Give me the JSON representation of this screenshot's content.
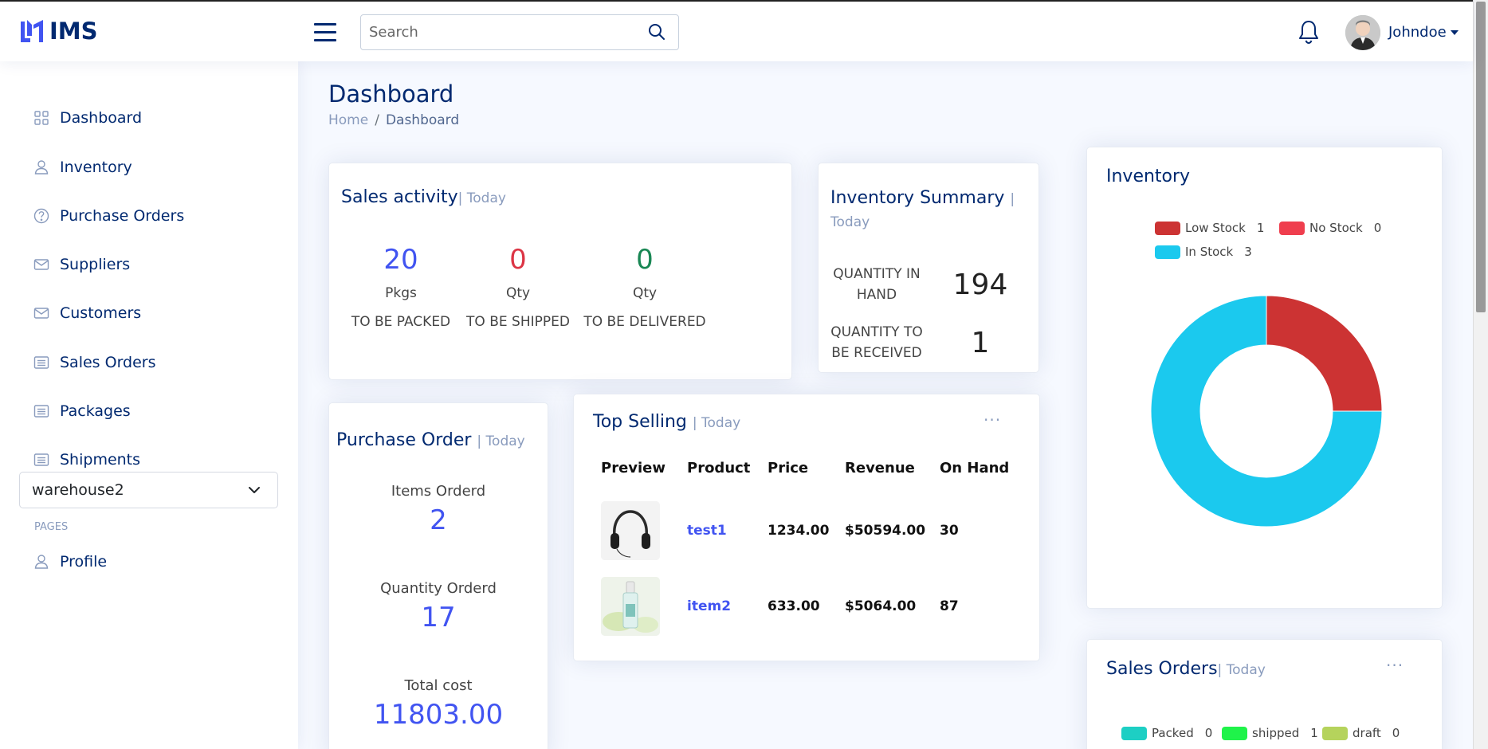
{
  "brand": {
    "name": "IMS"
  },
  "search": {
    "placeholder": "Search"
  },
  "user": {
    "name": "Johndoe"
  },
  "sidebar": {
    "items": [
      {
        "label": "Dashboard",
        "icon": "grid-icon"
      },
      {
        "label": "Inventory",
        "icon": "person-icon"
      },
      {
        "label": "Purchase Orders",
        "icon": "question-circle-icon"
      },
      {
        "label": "Suppliers",
        "icon": "envelope-icon"
      },
      {
        "label": "Customers",
        "icon": "envelope-icon"
      },
      {
        "label": "Sales Orders",
        "icon": "list-icon"
      },
      {
        "label": "Packages",
        "icon": "list-icon"
      },
      {
        "label": "Shipments",
        "icon": "list-icon"
      }
    ],
    "warehouse": {
      "selected": "warehouse2"
    },
    "pages_heading": "PAGES",
    "pages": [
      {
        "label": "Profile",
        "icon": "person-icon"
      }
    ]
  },
  "page": {
    "title": "Dashboard",
    "breadcrumb": {
      "home": "Home",
      "separator": "/",
      "current": "Dashboard"
    }
  },
  "sales_activity": {
    "title": "Sales activity",
    "period": "| Today",
    "stats": [
      {
        "value": "20",
        "unit": "Pkgs",
        "label": "TO BE PACKED",
        "color": "#4154f1"
      },
      {
        "value": "0",
        "unit": "Qty",
        "label": "TO BE SHIPPED",
        "color": "#dc3545"
      },
      {
        "value": "0",
        "unit": "Qty",
        "label": "TO BE DELIVERED",
        "color": "#198754"
      }
    ]
  },
  "inventory_summary": {
    "title": "Inventory Summary",
    "period": "| Today",
    "rows": [
      {
        "label": "QUANTITY IN HAND",
        "value": "194"
      },
      {
        "label": "QUANTITY TO BE RECEIVED",
        "value": "1"
      }
    ]
  },
  "purchase_order": {
    "title": "Purchase Order",
    "period": "| Today",
    "stats": [
      {
        "label": "Items Orderd",
        "value": "2"
      },
      {
        "label": "Quantity Orderd",
        "value": "17"
      },
      {
        "label": "Total cost",
        "value": "11803.00"
      }
    ]
  },
  "top_selling": {
    "title": "Top Selling",
    "period": "| Today",
    "menu": "...",
    "columns": [
      "Preview",
      "Product",
      "Price",
      "Revenue",
      "On Hand"
    ],
    "rows": [
      {
        "preview": "headphones-image",
        "product": "test1",
        "price": "1234.00",
        "revenue": "$50594.00",
        "on_hand": "30"
      },
      {
        "preview": "serum-bottle-image",
        "product": "item2",
        "price": "633.00",
        "revenue": "$5064.00",
        "on_hand": "87"
      }
    ]
  },
  "inventory_chart": {
    "title": "Inventory"
  },
  "chart_data": {
    "type": "pie",
    "variant": "doughnut",
    "title": "",
    "labels": [
      "Low Stock",
      "No Stock",
      "In Stock"
    ],
    "values": [
      1,
      0,
      3
    ],
    "colors": [
      "#cc3333",
      "#ef3e4e",
      "#1bc9ee"
    ],
    "legend": "top"
  },
  "sales_orders": {
    "title": "Sales Orders",
    "period": "| Today",
    "menu": "...",
    "legend": [
      {
        "label": "Packed",
        "count": "0",
        "color": "#1dcfc4"
      },
      {
        "label": "shipped",
        "count": "1",
        "color": "#1ff34a"
      },
      {
        "label": "draft",
        "count": "0",
        "color": "#b5d35c"
      }
    ]
  }
}
